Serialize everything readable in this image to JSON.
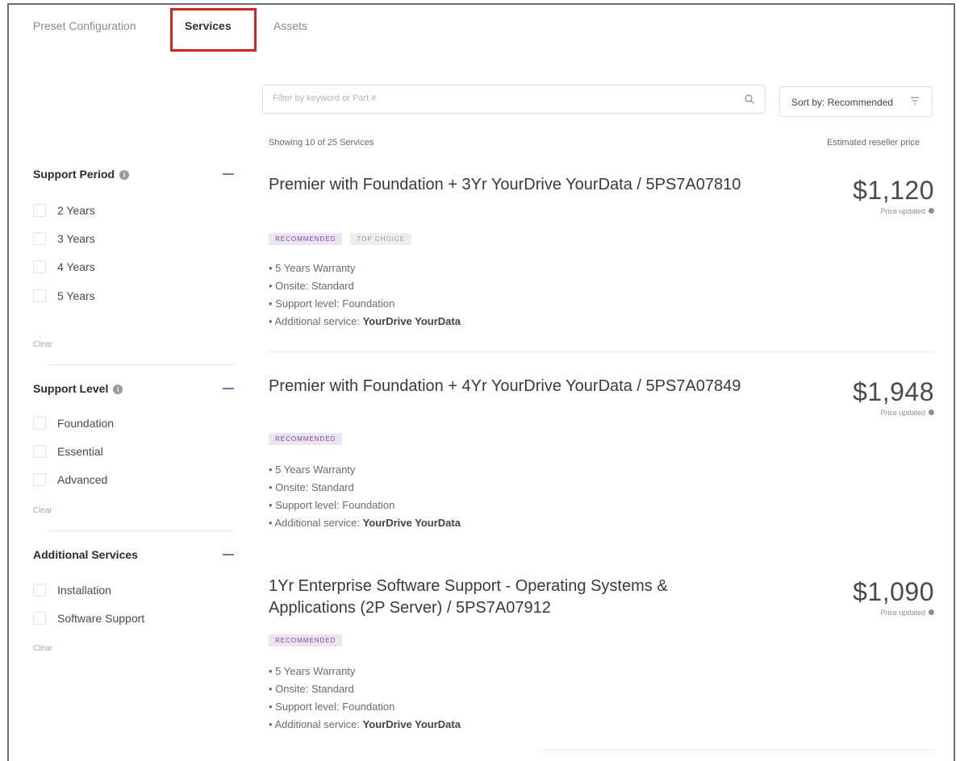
{
  "tabs": [
    {
      "label": "Preset Configuration",
      "active": false
    },
    {
      "label": "Services",
      "active": true
    },
    {
      "label": "Assets",
      "active": false
    }
  ],
  "search": {
    "placeholder": "Filter by keyword or Part #",
    "icon": "search-icon"
  },
  "sort": {
    "label": "Sort by: Recommended",
    "icon": "filter-icon"
  },
  "results": {
    "showing": "Showing 10 of 25 Services",
    "price_header": "Estimated reseller price"
  },
  "facets": [
    {
      "title": "Support Period",
      "has_info": true,
      "options": [
        "2 Years",
        "3 Years",
        "4 Years",
        "5 Years"
      ],
      "clear": "Clear"
    },
    {
      "title": "Support Level",
      "has_info": true,
      "options": [
        "Foundation",
        "Essential",
        "Advanced"
      ],
      "clear": "Clear"
    },
    {
      "title": "Additional Services",
      "has_info": false,
      "options": [
        "Installation",
        "Software Support"
      ],
      "clear": "Clear"
    }
  ],
  "services": [
    {
      "title": "Premier with Foundation + 3Yr YourDrive YourData / 5PS7A07810",
      "price": "$1,120",
      "price_note": "Price updated",
      "badges": [
        "RECOMMENDED",
        "TOP CHOICE"
      ],
      "bullets": [
        {
          "text": "5 Years Warranty",
          "bold": ""
        },
        {
          "text": "Onsite: Standard",
          "bold": ""
        },
        {
          "text": "Support level: Foundation",
          "bold": ""
        },
        {
          "text": "Additional service: ",
          "bold": "YourDrive YourData"
        }
      ]
    },
    {
      "title": "Premier with Foundation + 4Yr YourDrive YourData / 5PS7A07849",
      "price": "$1,948",
      "price_note": "Price updated",
      "badges": [
        "RECOMMENDED"
      ],
      "bullets": [
        {
          "text": "5 Years Warranty",
          "bold": ""
        },
        {
          "text": "Onsite: Standard",
          "bold": ""
        },
        {
          "text": "Support level: Foundation",
          "bold": ""
        },
        {
          "text": "Additional service: ",
          "bold": "YourDrive YourData"
        }
      ]
    },
    {
      "title": "1Yr Enterprise Software Support - Operating Systems & Applications (2P Server) / 5PS7A07912",
      "price": "$1,090",
      "price_note": "Price updated",
      "badges": [
        "RECOMMENDED"
      ],
      "bullets": [
        {
          "text": "5 Years Warranty",
          "bold": ""
        },
        {
          "text": "Onsite: Standard",
          "bold": ""
        },
        {
          "text": "Support level: Foundation",
          "bold": ""
        },
        {
          "text": "Additional service: ",
          "bold": "YourDrive YourData"
        }
      ]
    }
  ]
}
